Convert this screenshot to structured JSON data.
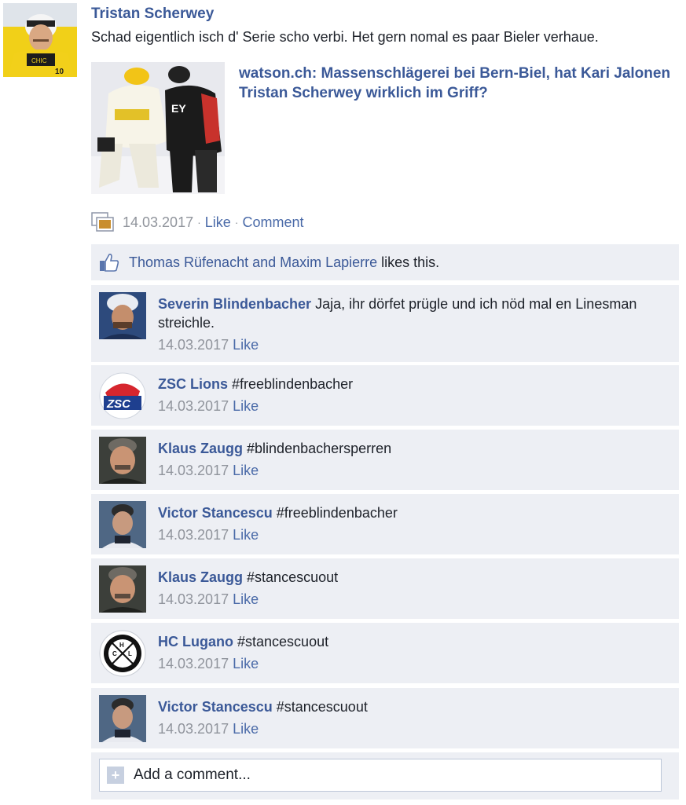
{
  "post": {
    "author": "Tristan Scherwey",
    "text": "Schad eigentlich isch d' Serie scho verbi. Het gern nomal es paar Bieler verhaue.",
    "attachment_title": "watson.ch: Massenschlägerei bei Bern-Biel, hat Kari Jalonen Tristan Scherwey wirklich im Griff?",
    "date": "14.03.2017",
    "like_label": "Like",
    "comment_label": "Comment",
    "separator": "·"
  },
  "likes": {
    "names": "Thomas Rüfenacht and Maxim Lapierre",
    "suffix": "likes this."
  },
  "comments": [
    {
      "author": "Severin Blindenbacher",
      "text": "Jaja, ihr dörfet prügle und ich nöd mal en Linesman streichle.",
      "date": "14.03.2017",
      "like": "Like",
      "avatar": "person-avatar"
    },
    {
      "author": "ZSC Lions",
      "text": "#freeblindenbacher",
      "date": "14.03.2017",
      "like": "Like",
      "avatar": "zsc-lions-logo"
    },
    {
      "author": "Klaus Zaugg",
      "text": "#blindenbachersperren",
      "date": "14.03.2017",
      "like": "Like",
      "avatar": "person-avatar"
    },
    {
      "author": "Victor Stancescu",
      "text": "#freeblindenbacher",
      "date": "14.03.2017",
      "like": "Like",
      "avatar": "person-avatar"
    },
    {
      "author": "Klaus Zaugg",
      "text": "#stancescuout",
      "date": "14.03.2017",
      "like": "Like",
      "avatar": "person-avatar"
    },
    {
      "author": "HC Lugano",
      "text": "#stancescuout",
      "date": "14.03.2017",
      "like": "Like",
      "avatar": "hc-lugano-logo"
    },
    {
      "author": "Victor Stancescu",
      "text": "#stancescuout",
      "date": "14.03.2017",
      "like": "Like",
      "avatar": "person-avatar"
    }
  ],
  "add_comment": {
    "placeholder": "Add a comment..."
  },
  "colors": {
    "link": "#3b5998",
    "panel": "#edeff4",
    "meta": "#90949c"
  }
}
